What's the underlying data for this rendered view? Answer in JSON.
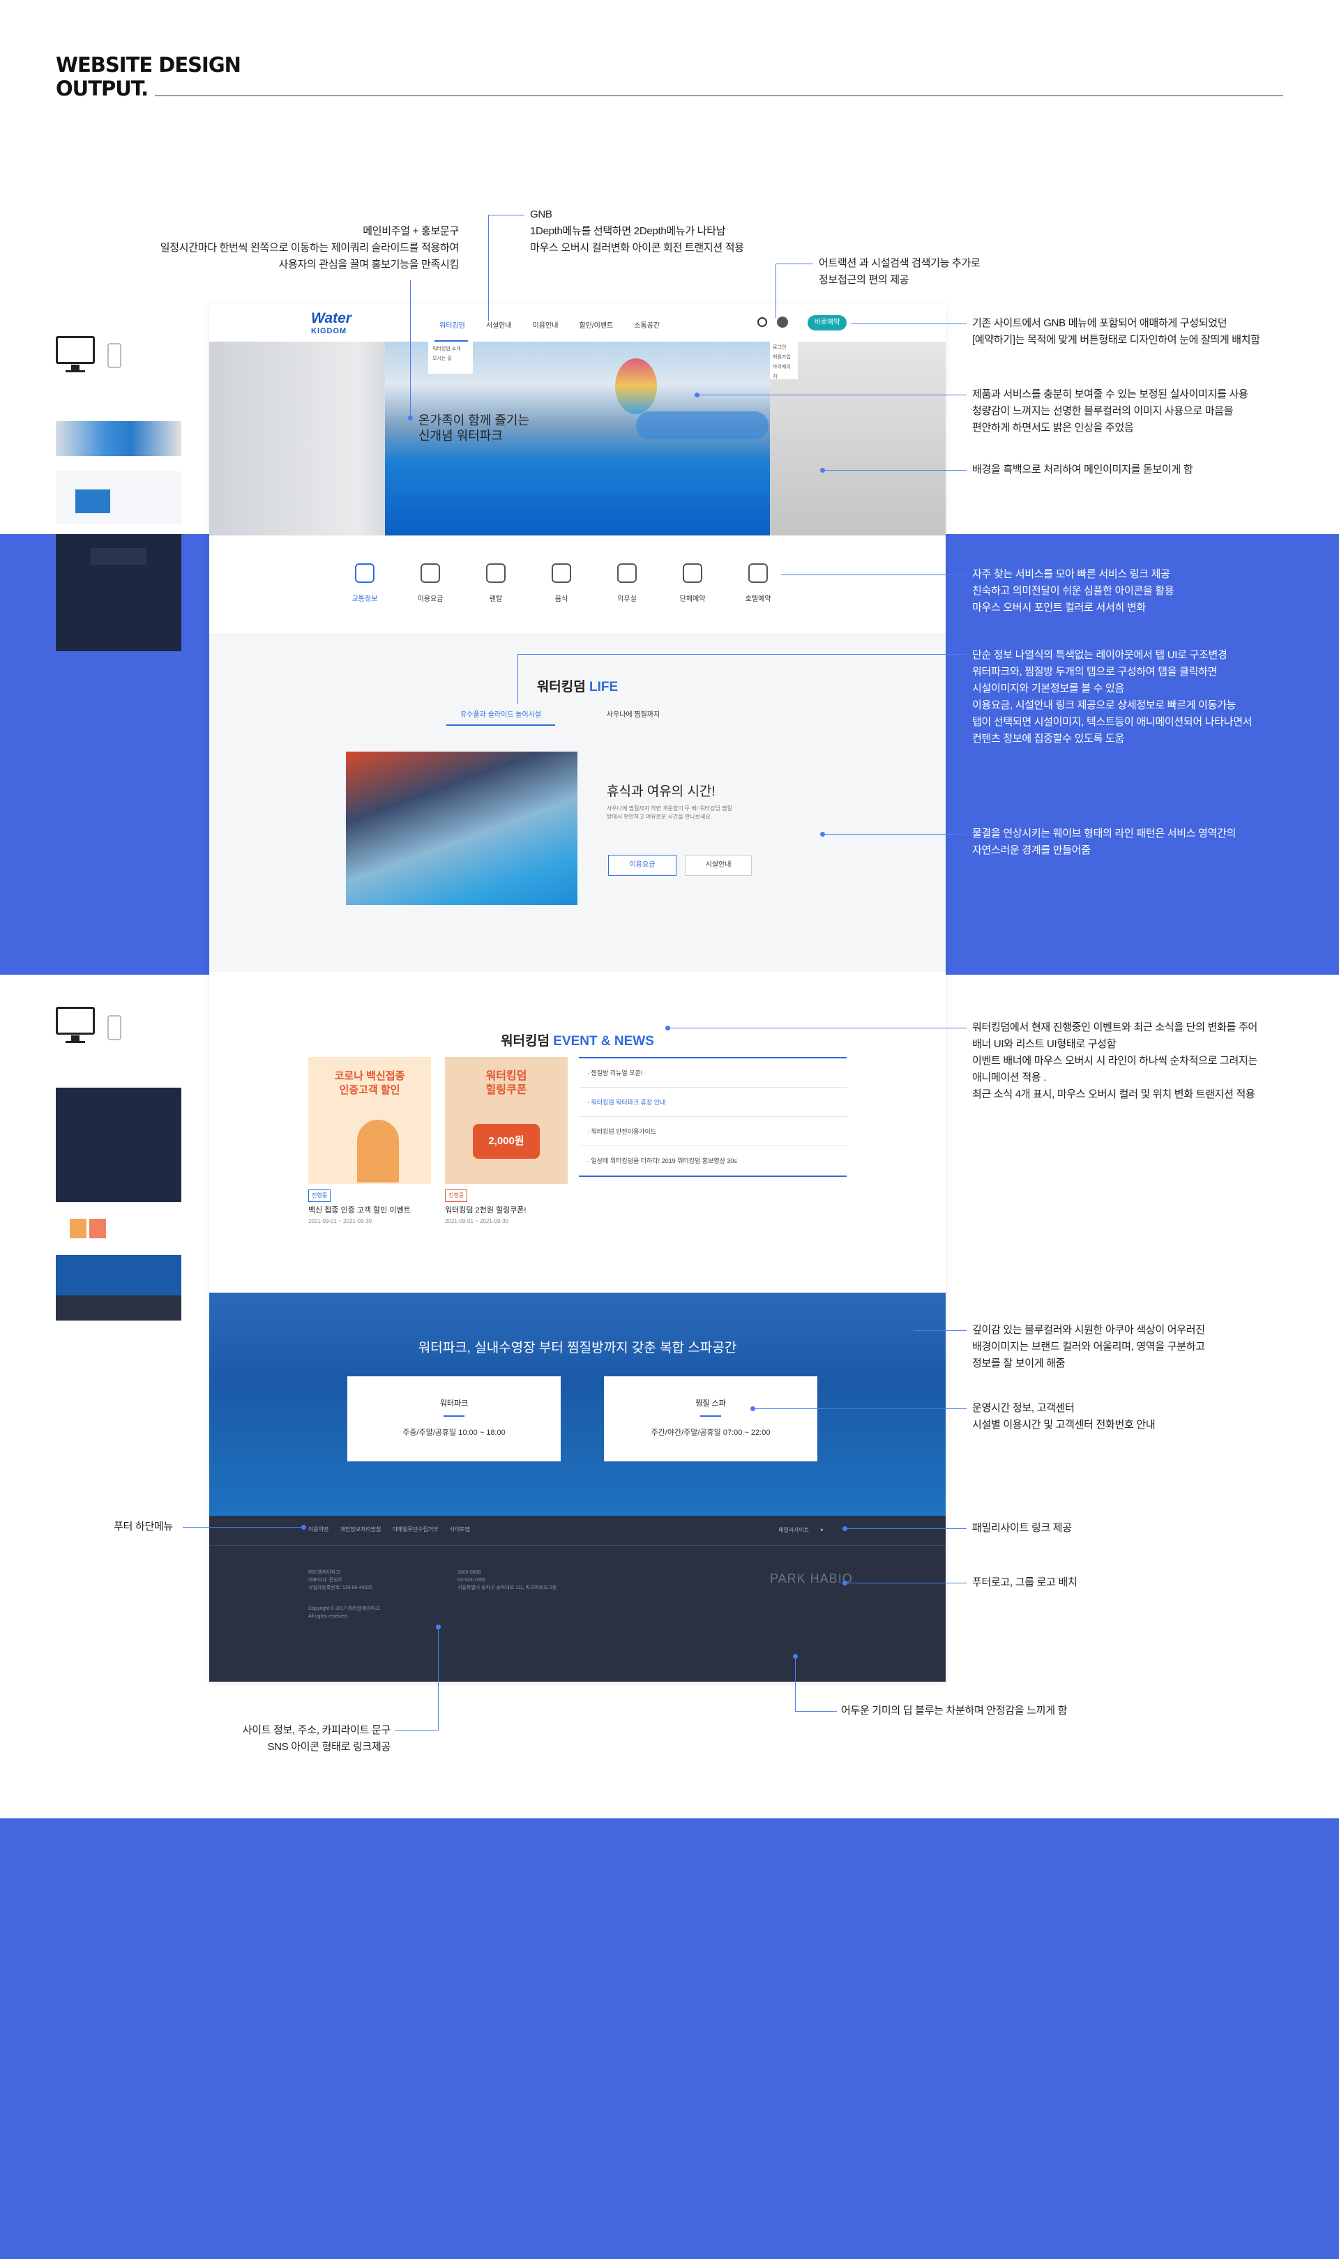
{
  "header": {
    "title_line1": "WEBSITE DESIGN",
    "title_line2": "OUTPUT."
  },
  "colors": {
    "accent": "#4467e0",
    "link_blue": "#2f6bdc",
    "footer": "#2a3143"
  },
  "annotations": {
    "main_visual": [
      "메인비주얼 + 홍보문구",
      "일정시간마다 한번씩 왼쪽으로 이동하는 제이쿼리 슬라이드를 적용하여",
      "사용자의 관심을 끌며 홍보기능을 만족시킴"
    ],
    "gnb": [
      "GNB",
      "1Depth메뉴를 선택하면 2Depth메뉴가 나타남",
      "마우스 오버시 컬러변화 아이콘 회전 트랜지션 적용"
    ],
    "attraction": [
      "어트랙션 과 시설검색 검색기능 추가로",
      "정보접근의 편의 제공"
    ],
    "reservation": [
      "기존 사이트에서 GNB 메뉴에 포함되어 애매하게 구성되었던",
      "[예약하기]는 목적에 맞게 버튼형태로 디자인하여 눈에 잘띄게 배치함"
    ],
    "photos": [
      "제품과 서비스를 충분히 보여줄 수 있는 보정된 실사이미지를 사용",
      "청량감이 느껴지는 선명한 블루컬러의 이미지 사용으로 마음을",
      "편안하게 하면서도 밝은 인상을 주었음"
    ],
    "background": [
      "배경을 흑백으로 처리하여 메인이미지를 돋보이게 함"
    ],
    "quick": [
      "자주 찾는 서비스를 모아 빠른 서비스 링크 제공",
      "친숙하고 의미전달이 쉬운 심플한 아이콘을 활용",
      "마우스 오버시 포인트 컬러로 서서히 변화"
    ],
    "life": [
      "단순 정보 나열식의 특색없는 레이아웃에서 탭 UI로 구조변경",
      "워터파크와, 찜질방 두개의 탭으로 구성하여 탭을 클릭하면",
      "시설이미지와 기본정보를 볼 수 있음",
      "이용요금, 시설안내 링크 제공으로 상세정보로 빠르게 이동가능",
      "탭이 선택되면 시설이미지, 텍스트등이 애니메이션되어 나타나면서",
      "컨텐츠 정보에 집중할수 있도록 도움"
    ],
    "wave": [
      "물결을 연상시키는 웨이브 형태의 라인 패턴은 서비스 영역간의",
      "자연스러운 경계를 만들어줌"
    ],
    "event": [
      "워터킹덤에서 현재 진행중인 이벤트와 최근 소식을 단의 변화를 주어",
      "배너 UI와 리스트 UI형태로 구성함",
      "이벤트 배너에 마우스 오버시 시 라인이 하나씩 순차적으로 그려지는",
      "애니메이션 적용 .",
      "최근 소식 4개 표시, 마우스 오버시 컬러 및 위치 변화 트랜지션 적용"
    ],
    "deep_blue": [
      "깊이감 있는 블루컬러와 시원한 아쿠아 색상이 어우러진",
      "배경이미지는 브랜드 컬러와 어울리며, 영역을 구분하고",
      "정보를 잘 보이게 해줌"
    ],
    "hours": [
      "운영시간 정보, 고객센터",
      "시설별 이용시간 및 고객센터 전화번호 안내"
    ],
    "footer_menu": [
      "푸터 하단메뉴"
    ],
    "family": [
      "패밀리사이트 링크 제공"
    ],
    "footer_logo": [
      "푸터로고, 그룹 로고 배치"
    ],
    "site_info": [
      "사이트 정보, 주소, 카피라이트 문구",
      "SNS 아이콘 형태로 링크제공"
    ],
    "dark_tone": [
      "어두운 기미의 딥 블루는 차분하며 안정감을 느끼게 함"
    ]
  },
  "site": {
    "logo_line1": "Water",
    "logo_line2": "KIGDOM",
    "nav": [
      "워터킹덤",
      "시설안내",
      "이용안내",
      "할인/이벤트",
      "소통공간"
    ],
    "nav_sub": [
      "워터킹덤 소개",
      "오시는 길"
    ],
    "user_menu": [
      "로그인",
      "회원가입",
      "마이페이지"
    ],
    "book_label": "바로예약",
    "hero_line1": "온가족이 함께 즐기는",
    "hero_line2": "신개념 워터파크",
    "quick": [
      "교통정보",
      "이용요금",
      "렌탈",
      "음식",
      "의무실",
      "단체예약",
      "호텔예약"
    ],
    "life_title_a": "워터킹덤",
    "life_title_b": "LIFE",
    "life_tabs": [
      "유수풀과 슬라이드 놀이시설",
      "사우나에 찜질까지"
    ],
    "life_heading": "휴식과 여유의 시간!",
    "life_text": "사우나에 찜질까지 하면 개운함이 두 배! 워터킹덤 찜질방에서 편안하고 여유로운 시간을 만나보세요.",
    "life_btn_price": "이용요금",
    "life_btn_info": "시설안내",
    "event_title_a": "워터킹덤",
    "event_title_b": "EVENT & NEWS",
    "card1_banner_line1": "코로나 백신접종",
    "card1_banner_line2": "인증고객 할인",
    "card2_banner_line1": "워터킹덤",
    "card2_banner_line2": "힐링쿠폰",
    "card2_coupon": "2,000원",
    "card1_tag": "진행중",
    "card1_title": "백신 접종 인증 고객 할인 이벤트",
    "card1_date": "2021-09-01 ~ 2021-09-30",
    "card2_tag": "진행중",
    "card2_title": "워터킹덤 2천원 힐링쿠폰!",
    "card2_date": "2021-09-01 ~ 2021-09-30",
    "news": [
      "찜질방 리뉴얼 오픈!",
      "워터킹덤 워터파크 휴장 안내",
      "워터킹덤 안전이용가이드",
      "일상에 워터킹덤을 더하다! 2019 워터킹덤 홍보영상 30s"
    ],
    "spa_title": "워터파크, 실내수영장 부터 찜질방까지 갖춘 복합 스파공간",
    "spa_cards": [
      {
        "title": "워터파크",
        "hours": "주중/주말/공휴일 10:00 ~ 18:00"
      },
      {
        "title": "찜질 스파",
        "hours": "주간/야간/주말/공휴일 07:00 ~ 22:00"
      }
    ],
    "footer_menu": [
      "이용약관",
      "개인정보처리방침",
      "이메일무단수집거부",
      "사이트맵"
    ],
    "family_label": "패밀리사이트",
    "footer_info_1": [
      "㈜티엠제이파크",
      "대표이사: 전성우",
      "사업자등록번호: 119-86-44325"
    ],
    "footer_info_2": [
      "1600-0668",
      "02-543-1005",
      "서울특별시 송파구 송파대로 111, 파크하비오 2층"
    ],
    "copyright": [
      "Copyright © 2017 ㈜티엠제이파크.",
      "All rights reserved."
    ],
    "footer_logo_text": "PARK HABIO"
  }
}
